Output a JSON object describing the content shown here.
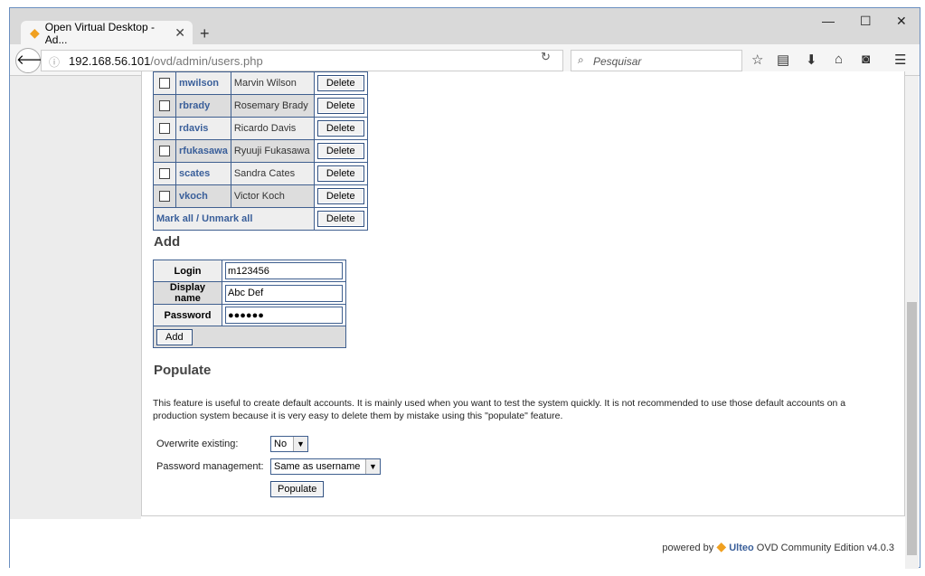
{
  "browser": {
    "tab_title": "Open Virtual Desktop - Ad...",
    "url_host": "192.168.56.101",
    "url_path": "/ovd/admin/users.php",
    "search_placeholder": "Pesquisar"
  },
  "users": [
    {
      "login": "mwilson",
      "name": "Marvin Wilson",
      "action": "Delete"
    },
    {
      "login": "rbrady",
      "name": "Rosemary Brady",
      "action": "Delete"
    },
    {
      "login": "rdavis",
      "name": "Ricardo Davis",
      "action": "Delete"
    },
    {
      "login": "rfukasawa",
      "name": "Ryuuji Fukasawa",
      "action": "Delete"
    },
    {
      "login": "scates",
      "name": "Sandra Cates",
      "action": "Delete"
    },
    {
      "login": "vkoch",
      "name": "Victor Koch",
      "action": "Delete"
    }
  ],
  "mark_all": "Mark all",
  "unmark_all": "Unmark all",
  "sep": " / ",
  "delete_selected": "Delete",
  "add": {
    "title": "Add",
    "login_label": "Login",
    "login_value": "m123456",
    "display_label": "Display name",
    "display_value": "Abc Def",
    "password_label": "Password",
    "password_value": "●●●●●●",
    "button": "Add"
  },
  "populate": {
    "title": "Populate",
    "description": "This feature is useful to create default accounts. It is mainly used when you want to test the system quickly. It is not recommended to use those default accounts on a production system because it is very easy to delete them by mistake using this \"populate\" feature.",
    "overwrite_label": "Overwrite existing:",
    "overwrite_value": "No",
    "password_label": "Password management:",
    "password_value": "Same as username",
    "button": "Populate"
  },
  "footer": {
    "powered": "powered by",
    "brand": "Ulteo",
    "edition": "OVD Community Edition v4.0.3"
  }
}
